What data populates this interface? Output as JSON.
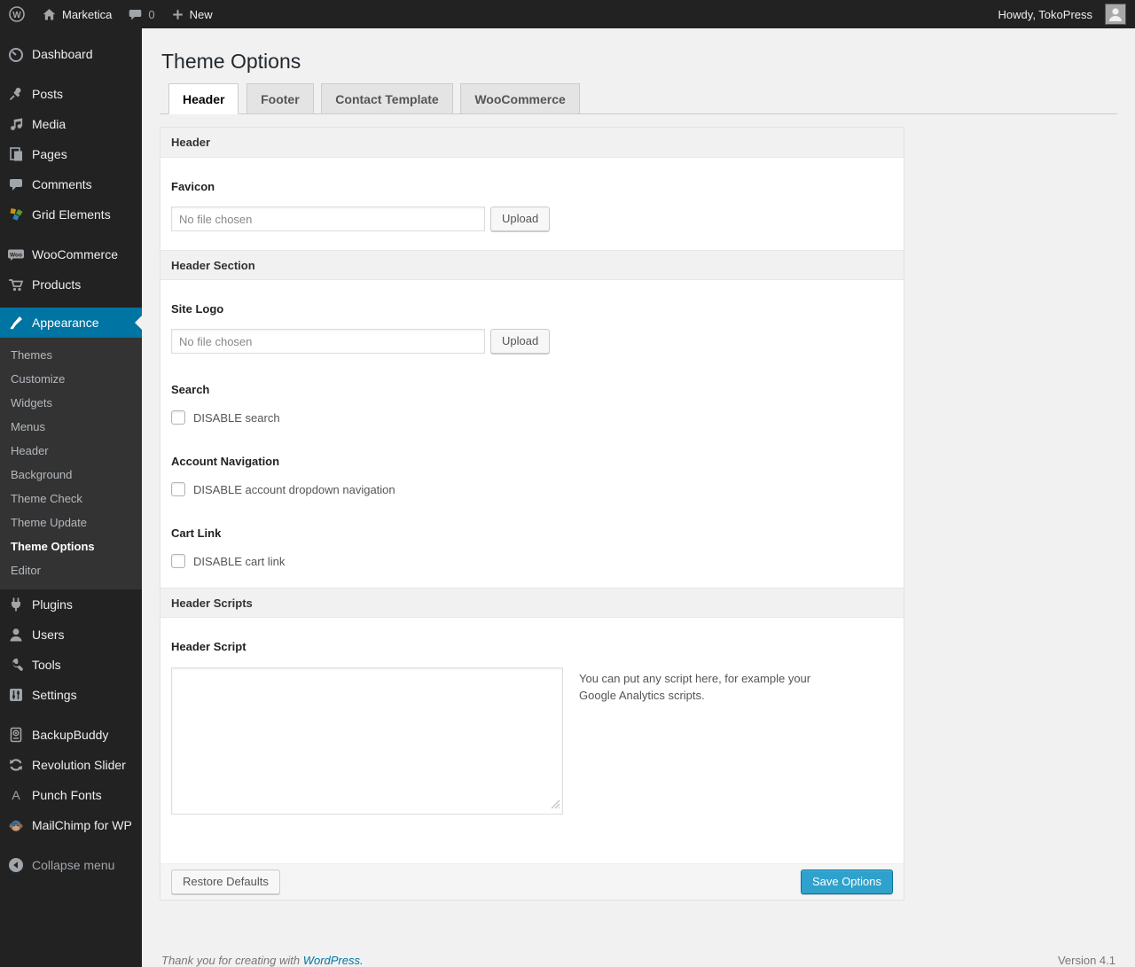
{
  "admin_bar": {
    "site_name": "Marketica",
    "comments_count": "0",
    "new_label": "New",
    "howdy": "Howdy, TokoPress"
  },
  "sidebar": {
    "items": [
      {
        "label": "Dashboard",
        "icon": "dashboard-icon"
      },
      {
        "label": "Posts",
        "icon": "pushpin-icon"
      },
      {
        "label": "Media",
        "icon": "media-icon"
      },
      {
        "label": "Pages",
        "icon": "pages-icon"
      },
      {
        "label": "Comments",
        "icon": "comment-icon"
      },
      {
        "label": "Grid Elements",
        "icon": "grid-elements-icon"
      },
      {
        "label": "WooCommerce",
        "icon": "woocommerce-icon"
      },
      {
        "label": "Products",
        "icon": "cart-icon"
      },
      {
        "label": "Appearance",
        "icon": "brush-icon",
        "active": true
      },
      {
        "label": "Plugins",
        "icon": "plugin-icon"
      },
      {
        "label": "Users",
        "icon": "user-icon"
      },
      {
        "label": "Tools",
        "icon": "wrench-icon"
      },
      {
        "label": "Settings",
        "icon": "settings-icon"
      },
      {
        "label": "BackupBuddy",
        "icon": "backup-drive-icon"
      },
      {
        "label": "Revolution Slider",
        "icon": "refresh-arrows-icon"
      },
      {
        "label": "Punch Fonts",
        "icon": "letter-a-icon"
      },
      {
        "label": "MailChimp for WP",
        "icon": "mailchimp-monkey-icon"
      },
      {
        "label": "Collapse menu",
        "icon": "collapse-arrow-icon"
      }
    ],
    "appearance_submenu": [
      "Themes",
      "Customize",
      "Widgets",
      "Menus",
      "Header",
      "Background",
      "Theme Check",
      "Theme Update",
      "Theme Options",
      "Editor"
    ],
    "current_submenu": "Theme Options"
  },
  "page": {
    "title": "Theme Options",
    "tabs": [
      {
        "label": "Header",
        "active": true
      },
      {
        "label": "Footer",
        "active": false
      },
      {
        "label": "Contact Template",
        "active": false
      },
      {
        "label": "WooCommerce",
        "active": false
      }
    ]
  },
  "panel": {
    "header_section_title": "Header",
    "favicon": {
      "label": "Favicon",
      "value": "No file chosen",
      "upload_label": "Upload"
    },
    "header_section2_title": "Header Section",
    "site_logo": {
      "label": "Site Logo",
      "value": "No file chosen",
      "upload_label": "Upload"
    },
    "search": {
      "label": "Search",
      "checkbox_label": "DISABLE search"
    },
    "account_nav": {
      "label": "Account Navigation",
      "checkbox_label": "DISABLE account dropdown navigation"
    },
    "cart_link": {
      "label": "Cart Link",
      "checkbox_label": "DISABLE cart link"
    },
    "scripts_section_title": "Header Scripts",
    "header_script": {
      "label": "Header Script",
      "value": "",
      "hint": "You can put any script here, for example your Google Analytics scripts."
    },
    "restore_label": "Restore Defaults",
    "save_label": "Save Options"
  },
  "footer": {
    "thankyou_prefix": "Thank you for creating with ",
    "wordpress_link": "WordPress.",
    "version": "Version 4.1"
  },
  "colors": {
    "admin_bar_bg": "#222222",
    "menu_highlight": "#0074a2",
    "primary_button": "#2ea2cc",
    "content_bg": "#f1f1f1",
    "icon_gray": "#a0a5aa"
  }
}
